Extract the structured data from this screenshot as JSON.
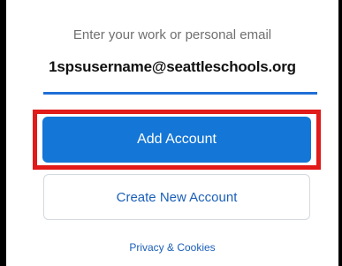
{
  "form": {
    "prompt": "Enter your work or personal email",
    "email_value": "1spsusername@seattleschools.org",
    "add_account_label": "Add Account",
    "create_account_label": "Create New Account",
    "privacy_label": "Privacy & Cookies"
  },
  "colors": {
    "accent": "#1476d6",
    "link": "#1b5fb8",
    "highlight": "#e11a1a"
  }
}
